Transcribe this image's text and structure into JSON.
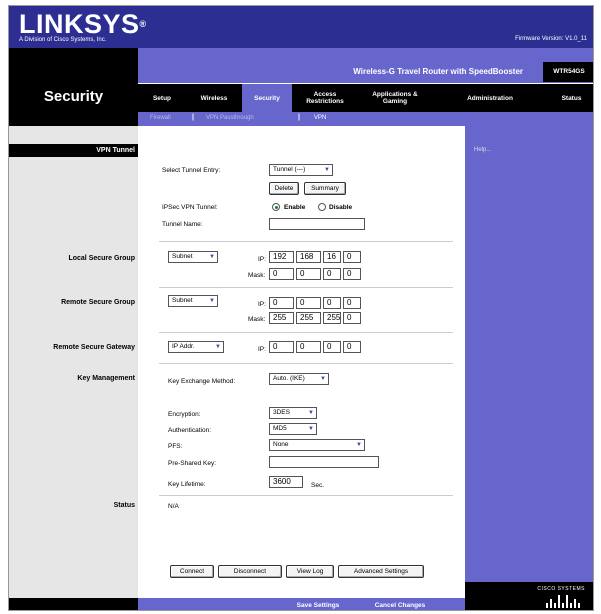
{
  "header": {
    "logo": "LINKSYS",
    "logo_reg": "®",
    "logo_sub": "A Division of Cisco Systems, Inc.",
    "firmware": "Firmware Version: V1.0_11",
    "section_title": "Security",
    "product_name": "Wireless-G Travel Router with SpeedBooster",
    "model": "WTR54GS"
  },
  "menu": {
    "tabs": [
      {
        "label": "Setup"
      },
      {
        "label": "Wireless"
      },
      {
        "label": "Security"
      },
      {
        "label": "Access\nRestrictions"
      },
      {
        "label": "Applications &\nGaming"
      },
      {
        "label": "Administration"
      },
      {
        "label": "Status"
      }
    ],
    "active_tab": "Security",
    "subtabs": [
      {
        "label": "Firewall"
      },
      {
        "label": "VPN Passthrough"
      },
      {
        "label": "VPN"
      }
    ],
    "separator": "|"
  },
  "help_link": "Help...",
  "sections": {
    "vpn_tunnel": "VPN Tunnel",
    "local_secure_group": "Local Secure Group",
    "remote_secure_group": "Remote Secure Group",
    "remote_secure_gateway": "Remote Secure Gateway",
    "key_management": "Key Management",
    "status": "Status"
  },
  "tunnel": {
    "select_label": "Select Tunnel Entry:",
    "select_value": "Tunnel (---)",
    "delete_btn": "Delete",
    "summary_btn": "Summary",
    "ipsec_label": "IPSec VPN Tunnel:",
    "enable_label": "Enable",
    "disable_label": "Disable",
    "ipsec_selected": "Enable",
    "name_label": "Tunnel Name:",
    "name_value": ""
  },
  "local_group": {
    "type": "Subnet",
    "ip_label": "IP:",
    "ip": [
      "192",
      "168",
      "16",
      "0"
    ],
    "mask_label": "Mask:",
    "mask": [
      "0",
      "0",
      "0",
      "0"
    ]
  },
  "remote_group": {
    "type": "Subnet",
    "ip_label": "IP:",
    "ip": [
      "0",
      "0",
      "0",
      "0"
    ],
    "mask_label": "Mask:",
    "mask": [
      "255",
      "255",
      "255",
      "0"
    ]
  },
  "remote_gateway": {
    "type": "IP Addr.",
    "ip_label": "IP:",
    "ip": [
      "0",
      "0",
      "0",
      "0"
    ]
  },
  "key_mgmt": {
    "exchange_label": "Key Exchange Method:",
    "exchange_value": "Auto. (IKE)",
    "encryption_label": "Encryption:",
    "encryption_value": "3DES",
    "auth_label": "Authentication:",
    "auth_value": "MD5",
    "pfs_label": "PFS:",
    "pfs_value": "None",
    "psk_label": "Pre-Shared Key:",
    "psk_value": "",
    "lifetime_label": "Key Lifetime:",
    "lifetime_value": "3600",
    "lifetime_unit": "Sec."
  },
  "status": {
    "value": "N/A"
  },
  "actions": {
    "connect": "Connect",
    "disconnect": "Disconnect",
    "view_log": "View Log",
    "advanced": "Advanced Settings"
  },
  "footer": {
    "save": "Save Settings",
    "cancel": "Cancel Changes",
    "cisco": "CISCO SYSTEMS"
  },
  "colors": {
    "brand_blue": "#2c2e92",
    "accent_purple": "#6666cc"
  },
  "icons": [
    "dropdown-arrow-icon",
    "cisco-logo-icon"
  ]
}
